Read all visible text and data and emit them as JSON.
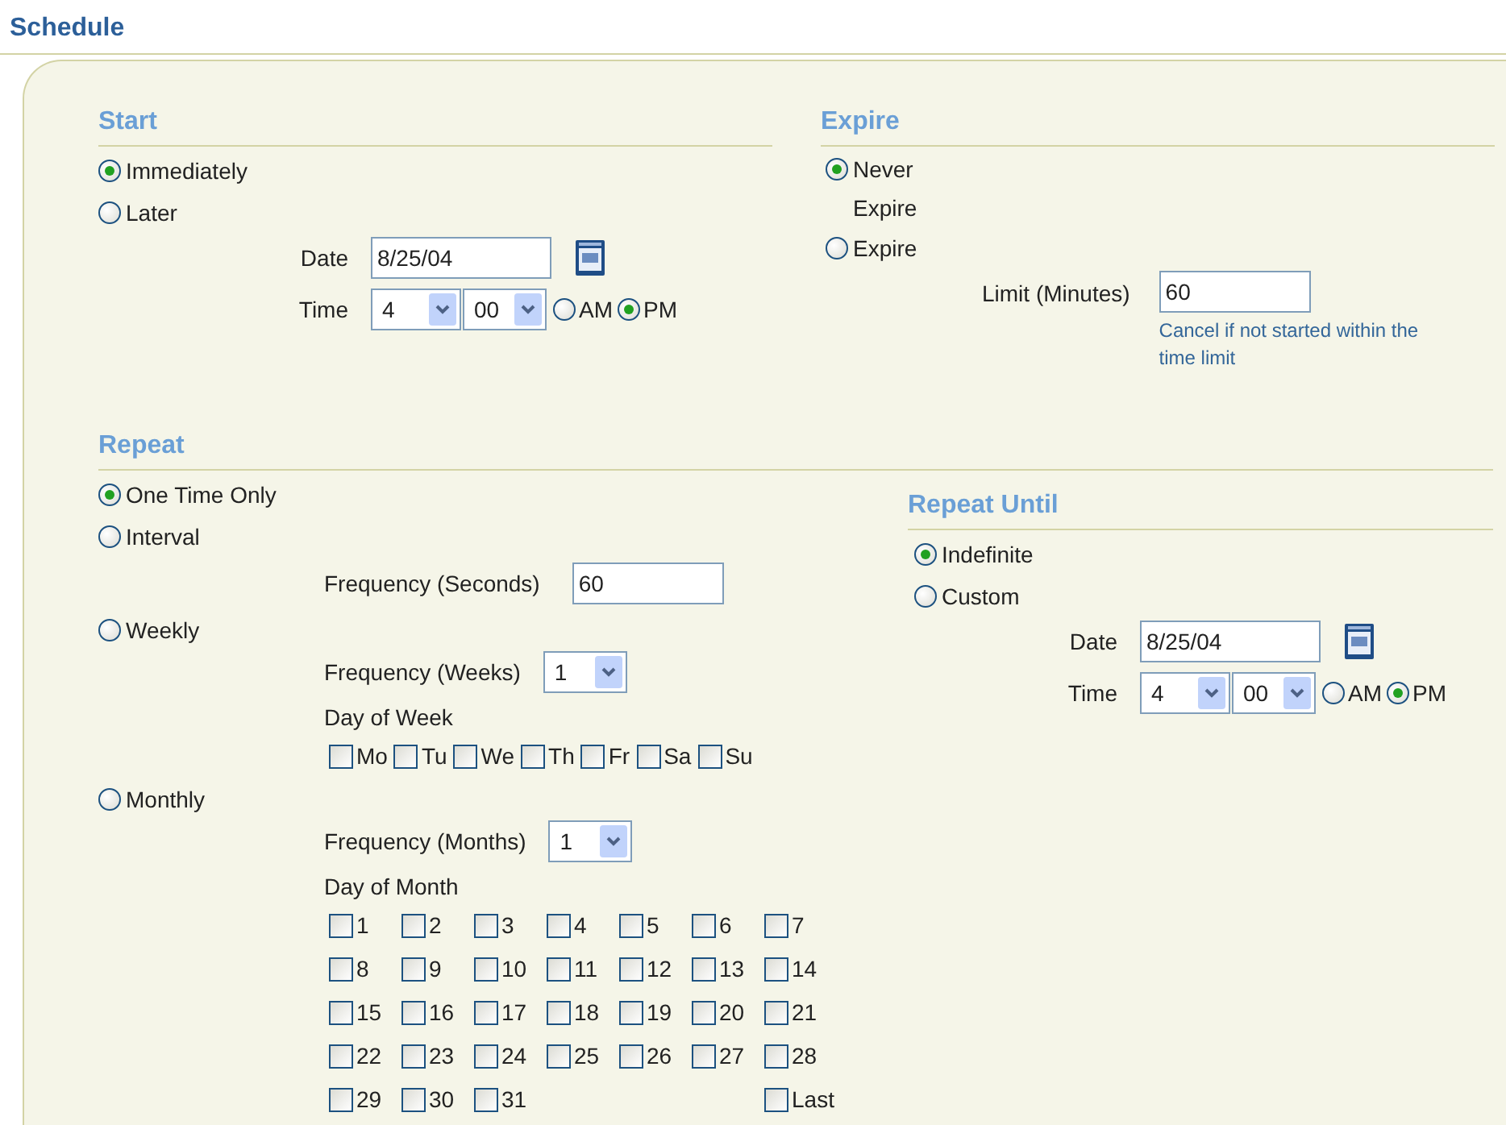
{
  "title": "Schedule",
  "start": {
    "heading": "Start",
    "options": [
      {
        "label": "Immediately",
        "selected": true
      },
      {
        "label": "Later",
        "selected": false
      }
    ],
    "date": {
      "label": "Date",
      "value": "8/25/04"
    },
    "time": {
      "label": "Time",
      "hour": "4",
      "minute": "00",
      "periods": [
        {
          "label": "AM",
          "selected": false
        },
        {
          "label": "PM",
          "selected": true
        }
      ]
    }
  },
  "expire": {
    "heading": "Expire",
    "options": [
      {
        "label": "Never Expire",
        "selected": true
      },
      {
        "label": "Expire",
        "selected": false
      }
    ],
    "limit": {
      "label": "Limit (Minutes)",
      "value": "60",
      "hint": "Cancel if not started within the time limit"
    }
  },
  "repeat": {
    "heading": "Repeat",
    "options": [
      {
        "kind": "plain",
        "label": "One Time Only",
        "selected": true
      },
      {
        "kind": "interval",
        "label": "Interval",
        "selected": false,
        "frequency": {
          "label": "Frequency (Seconds)",
          "value": "60"
        }
      },
      {
        "kind": "weekly",
        "label": "Weekly",
        "selected": false,
        "frequency": {
          "label": "Frequency (Weeks)",
          "value": "1"
        },
        "days_heading": "Day of Week",
        "days": [
          {
            "label": "Mo",
            "checked": false
          },
          {
            "label": "Tu",
            "checked": false
          },
          {
            "label": "We",
            "checked": false
          },
          {
            "label": "Th",
            "checked": false
          },
          {
            "label": "Fr",
            "checked": false
          },
          {
            "label": "Sa",
            "checked": false
          },
          {
            "label": "Su",
            "checked": false
          }
        ]
      },
      {
        "kind": "monthly",
        "label": "Monthly",
        "selected": false,
        "frequency": {
          "label": "Frequency (Months)",
          "value": "1"
        },
        "days_heading": "Day of Month",
        "days": [
          {
            "label": "1",
            "checked": false
          },
          {
            "label": "2",
            "checked": false
          },
          {
            "label": "3",
            "checked": false
          },
          {
            "label": "4",
            "checked": false
          },
          {
            "label": "5",
            "checked": false
          },
          {
            "label": "6",
            "checked": false
          },
          {
            "label": "7",
            "checked": false
          },
          {
            "label": "8",
            "checked": false
          },
          {
            "label": "9",
            "checked": false
          },
          {
            "label": "10",
            "checked": false
          },
          {
            "label": "11",
            "checked": false
          },
          {
            "label": "12",
            "checked": false
          },
          {
            "label": "13",
            "checked": false
          },
          {
            "label": "14",
            "checked": false
          },
          {
            "label": "15",
            "checked": false
          },
          {
            "label": "16",
            "checked": false
          },
          {
            "label": "17",
            "checked": false
          },
          {
            "label": "18",
            "checked": false
          },
          {
            "label": "19",
            "checked": false
          },
          {
            "label": "20",
            "checked": false
          },
          {
            "label": "21",
            "checked": false
          },
          {
            "label": "22",
            "checked": false
          },
          {
            "label": "23",
            "checked": false
          },
          {
            "label": "24",
            "checked": false
          },
          {
            "label": "25",
            "checked": false
          },
          {
            "label": "26",
            "checked": false
          },
          {
            "label": "27",
            "checked": false
          },
          {
            "label": "28",
            "checked": false
          },
          {
            "label": "29",
            "checked": false
          },
          {
            "label": "30",
            "checked": false
          },
          {
            "label": "31",
            "checked": false
          }
        ],
        "last": {
          "label": "Last",
          "checked": false
        }
      }
    ]
  },
  "repeat_until": {
    "heading": "Repeat Until",
    "options": [
      {
        "label": "Indefinite",
        "selected": true
      },
      {
        "label": "Custom",
        "selected": false
      }
    ],
    "date": {
      "label": "Date",
      "value": "8/25/04"
    },
    "time": {
      "label": "Time",
      "hour": "4",
      "minute": "00",
      "periods": [
        {
          "label": "AM",
          "selected": false
        },
        {
          "label": "PM",
          "selected": true
        }
      ]
    }
  }
}
